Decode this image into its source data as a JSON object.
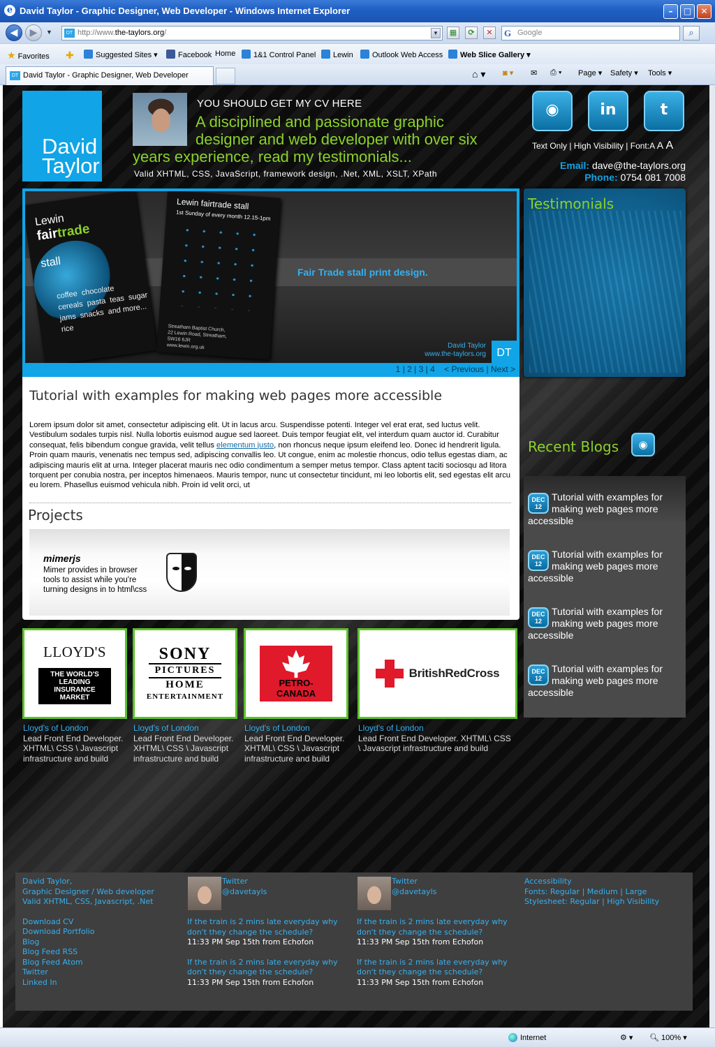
{
  "window": {
    "title": "David Taylor - Graphic Designer, Web Developer - Windows Internet Explorer",
    "min": "–",
    "max": "□",
    "close": "✕"
  },
  "address": {
    "prefix": "http://www.",
    "host": "the-taylors.org",
    "suffix": "/",
    "search_placeholder": "Google"
  },
  "favorites": {
    "label": "Favorites",
    "items": [
      "Suggested Sites ▾",
      "Facebook",
      "Home",
      "1&1 Control Panel",
      "Lewin",
      "Outlook Web Access",
      "Web Slice Gallery ▾"
    ]
  },
  "tab": {
    "label": "David Taylor - Graphic Designer, Web Developer"
  },
  "commands": {
    "page": "Page ▾",
    "safety": "Safety ▾",
    "tools": "Tools ▾"
  },
  "site": {
    "logo": {
      "line1": "David",
      "line2": "Taylor"
    },
    "cv_heading": "YOU SHOULD GET MY CV HERE",
    "tagline_1": "A disciplined and passionate graphic",
    "tagline_2": "designer and web developer with over six",
    "tagline_3": "years experience, read my testimonials...",
    "skills": "Valid XHTML, CSS, JavaScript, framework design, .Net, XML, XSLT, XPath",
    "social": {
      "rss": "RSS",
      "linkedin": "in",
      "twitter": "t"
    },
    "access": {
      "text_only": "Text Only",
      "sep1": " | ",
      "high_vis": "High Visibility",
      "sep2": " | ",
      "font": "Font:",
      "a1": "A",
      "a2": "A",
      "a3": "A"
    },
    "contact": {
      "email_label": "Email:",
      "email": "dave@the-taylors.org",
      "phone_label": "Phone:",
      "phone": "0754 081 7008"
    },
    "hero": {
      "caption": "Fair Trade stall print design.",
      "credit_name": "David Taylor",
      "credit_url": "www.the-taylors.org",
      "badge": "DT",
      "pages": [
        "1",
        "2",
        "3",
        "4"
      ],
      "prev": "< Previous",
      "next": "Next >",
      "flyer": {
        "lewin": "Lewin",
        "fair": "fair",
        "trade": "trade",
        "stall": "stall",
        "words": "coffee  chocolate\ncereals  pasta  teas  sugar\njams  snacks  and more...\nrice",
        "address": "Streatham Baptist Church,\n22 Lewin Road, Streatham,\nSW16 6JR\nwww.lewin.org.uk",
        "top": "Lewin fairtrade stall",
        "sub": "1st Sunday of every month 12.15-1pm"
      }
    },
    "testimonials_title": "Testimonials",
    "article": {
      "title": "Tutorial with examples for making web pages more accessible",
      "body_1": "Lorem ipsum dolor sit amet, consectetur adipiscing elit. Ut in lacus arcu. Suspendisse potenti. Integer vel erat erat, sed luctus velit. Vestibulum sodales turpis nisl. Nulla lobortis euismod augue sed laoreet. Duis tempor feugiat elit, vel interdum quam auctor id. Curabitur consequat, felis bibendum congue gravida, velit tellus ",
      "link": "elementum justo",
      "body_2": ", non rhoncus neque ipsum eleifend leo. Donec id hendrerit ligula. Proin quam mauris, venenatis nec tempus sed, adipiscing convallis leo. Ut congue, enim ac molestie rhoncus, odio tellus egestas diam, ac adipiscing mauris elit at urna. Integer placerat mauris nec odio condimentum a semper metus tempor. Class aptent taciti sociosqu ad litora torquent per conubia nostra, per inceptos himenaeos. Mauris tempor, nunc ut consectetur tincidunt, mi leo lobortis elit, sed egestas elit arcu eu lorem. Phasellus euismod vehicula nibh. Proin id velit orci, ut"
    },
    "projects": {
      "title": "Projects",
      "item": {
        "name": "mimerjs",
        "desc": "Mimer provides in browser tools to assist while you're turning designs in to html\\css"
      }
    },
    "recent_blogs": {
      "title": "Recent Blogs",
      "posts": [
        {
          "month": "DEC",
          "day": "12",
          "title": "Tutorial with examples for making web pages more accessible"
        },
        {
          "month": "DEC",
          "day": "12",
          "title": "Tutorial with examples for making web pages more accessible"
        },
        {
          "month": "DEC",
          "day": "12",
          "title": "Tutorial with examples for making web pages more accessible"
        },
        {
          "month": "DEC",
          "day": "12",
          "title": "Tutorial with examples for making web pages more accessible"
        }
      ]
    },
    "clients": [
      {
        "logo_a": "LLOYD'S",
        "logo_b": "THE WORLD'S LEADING INSURANCE MARKET",
        "name": "Lloyd's of London",
        "desc": "Lead Front End Developer. XHTML\\ CSS \\ Javascript infrastructure and build"
      },
      {
        "logo_a": "SONY",
        "logo_b": "PICTURES",
        "logo_c": "HOME",
        "logo_d": "ENTERTAINMENT",
        "name": "Lloyd's of London",
        "desc": "Lead Front End Developer. XHTML\\ CSS \\ Javascript infrastructure and build"
      },
      {
        "logo_a": "PETRO-CANADA",
        "name": "Lloyd's of London",
        "desc": "Lead Front End Developer. XHTML\\ CSS \\ Javascript infrastructure and build"
      },
      {
        "logo_a": "BritishRedCross",
        "name": "Lloyd's of London",
        "desc": "Lead Front End Developer. XHTML\\ CSS \\ Javascript infrastructure and build"
      }
    ],
    "footer": {
      "col1": {
        "l1": "David Taylor,",
        "l2": "Graphic Designer / Web developer",
        "l3": "Valid XHTML, CSS, Javascript, .Net",
        "links": [
          "Download CV",
          "Download Portfolio",
          "Blog",
          "Blog Feed RSS",
          "Blog Feed Atom",
          "Twitter",
          "Linked In"
        ]
      },
      "twitter": {
        "label": "Twitter",
        "handle": "@davetayls",
        "tweets": [
          {
            "text": "If the train is 2 mins late everyday why don't they change the schedule?",
            "meta": "11:33 PM Sep 15th from Echofon"
          },
          {
            "text": "If the train is 2 mins late everyday why don't they change the schedule?",
            "meta": "11:33 PM Sep 15th from Echofon"
          }
        ]
      },
      "col4": {
        "title": "Accessibility",
        "fonts": "Fonts: Regular | Medium | Large",
        "style": "Stylesheet: Regular | High Visibility"
      }
    }
  },
  "status": {
    "zone": "Internet",
    "zoom": "100%"
  }
}
